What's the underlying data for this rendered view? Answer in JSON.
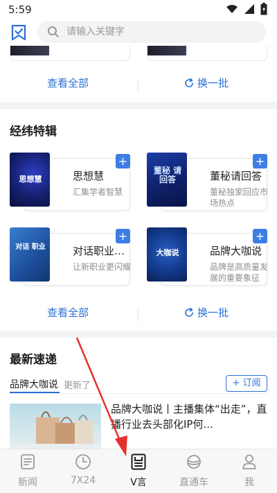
{
  "status_bar": {
    "time": "5:59"
  },
  "search": {
    "placeholder": "请输入关键字"
  },
  "top_section": {
    "view_all": "查看全部",
    "refresh": "换一批"
  },
  "albums_section": {
    "title": "经纬特辑",
    "items": [
      {
        "name": "思想慧",
        "desc": "汇集学者智慧",
        "cover_text": "思想慧",
        "add": "+"
      },
      {
        "name": "董秘请回答",
        "desc": "董秘独家回应市场热点",
        "cover_text": "董秘 请回答",
        "add": "+"
      },
      {
        "name": "对话职业经理人",
        "desc": "让新职业更闪耀",
        "cover_text": "对话 职业",
        "add": "+"
      },
      {
        "name": "品牌大咖说",
        "desc": "品牌是高质量发展的重要象征",
        "cover_text": "大咖说",
        "add": "+"
      }
    ],
    "view_all": "查看全部",
    "refresh": "换一批"
  },
  "latest_section": {
    "title": "最新速递",
    "tab_active": "品牌大咖说",
    "tab_updated": "更新了",
    "subscribe": "+ 订阅",
    "news_title": "品牌大咖说丨主播集体“出走”，直播行业去头部化IP何..."
  },
  "tab_bar": {
    "items": [
      {
        "label": "新闻",
        "icon": "news-icon"
      },
      {
        "label": "7X24",
        "icon": "clock-icon"
      },
      {
        "label": "V言",
        "icon": "v-yan-icon",
        "active": true
      },
      {
        "label": "直通车",
        "icon": "planet-icon"
      },
      {
        "label": "我",
        "icon": "person-icon"
      }
    ]
  },
  "colors": {
    "accent": "#2a6fd6",
    "add_button": "#3c7ee6",
    "arrow": "#e5312c"
  }
}
